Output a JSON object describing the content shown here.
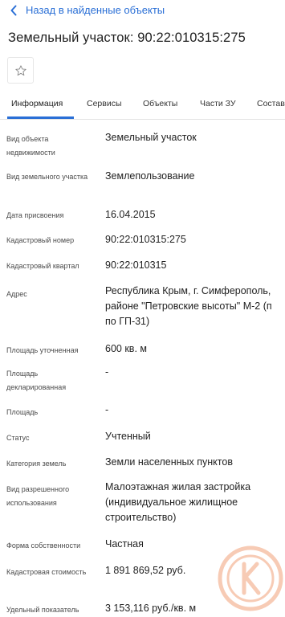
{
  "nav": {
    "back_label": "Назад в найденные объекты"
  },
  "page": {
    "title": "Земельный участок: 90:22:010315:275"
  },
  "tabs": [
    {
      "label": "Информация",
      "active": true
    },
    {
      "label": "Сервисы",
      "active": false
    },
    {
      "label": "Объекты",
      "active": false
    },
    {
      "label": "Части ЗУ",
      "active": false
    },
    {
      "label": "Состав",
      "active": false
    }
  ],
  "details": {
    "object_type": {
      "label": "Вид объекта недвижимости",
      "value": "Земельный участок"
    },
    "land_type": {
      "label": "Вид земельного участка",
      "value": "Землепользование"
    },
    "assign_date": {
      "label": "Дата присвоения",
      "value": "16.04.2015"
    },
    "cadastral_number": {
      "label": "Кадастровый номер",
      "value": "90:22:010315:275"
    },
    "cadastral_quarter": {
      "label": "Кадастровый квартал",
      "value": "90:22:010315"
    },
    "address": {
      "label": "Адрес",
      "value_lines": [
        "Республика Крым, г. Симферополь,",
        "районе \"Петровские высоты\" М-2 (п",
        "по ГП-31)"
      ]
    },
    "area_specified": {
      "label": "Площадь уточненная",
      "value": "600 кв. м"
    },
    "area_declared": {
      "label": "Площадь декларированная",
      "value": "-"
    },
    "area": {
      "label": "Площадь",
      "value": "-"
    },
    "status": {
      "label": "Статус",
      "value": "Учтенный"
    },
    "land_category": {
      "label": "Категория земель",
      "value": "Земли населенных пунктов"
    },
    "permitted_use": {
      "label": "Вид разрешенного использования",
      "value_lines": [
        "Малоэтажная жилая застройка",
        "(индивидуальное жилищное",
        "строительство)"
      ]
    },
    "ownership": {
      "label": "Форма собственности",
      "value": "Частная"
    },
    "cadastral_value": {
      "label": "Кадастровая стоимость",
      "value": "1 891 869,52 руб."
    },
    "specific_indicator": {
      "label": "Удельный показатель",
      "value": "3 153,116 руб./кв. м"
    }
  },
  "colors": {
    "accent": "#2a6fd6",
    "watermark": "#f2a27a"
  }
}
